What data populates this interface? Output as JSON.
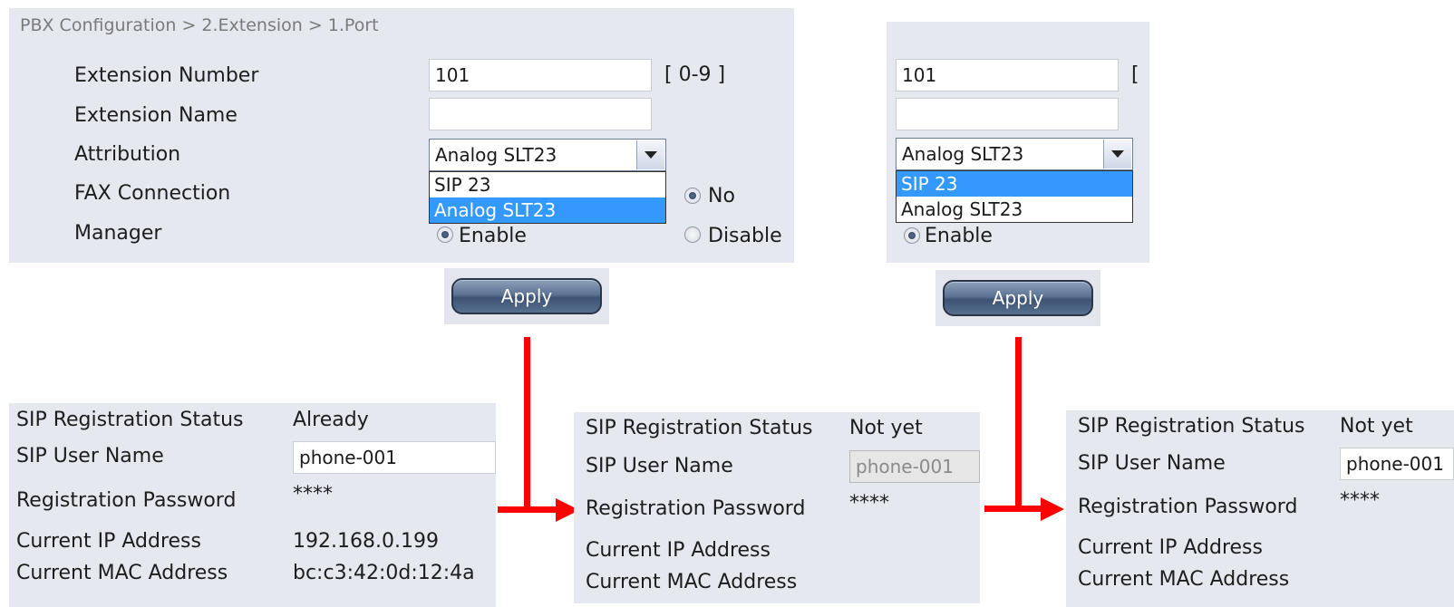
{
  "breadcrumb": "PBX Configuration > 2.Extension > 1.Port",
  "config_form": {
    "extension_number_label": "Extension Number",
    "extension_number_value": "101",
    "extension_number_hint": "[ 0-9 ]",
    "extension_name_label": "Extension Name",
    "extension_name_value": "",
    "attribution_label": "Attribution",
    "attribution_value": "Analog SLT23",
    "attribution_options": [
      "SIP 23",
      "Analog SLT23"
    ],
    "fax_label": "FAX Connection",
    "fax_no": "No",
    "manager_label": "Manager",
    "manager_enable": "Enable",
    "manager_disable": "Disable",
    "apply_label": "Apply"
  },
  "config_form_right": {
    "extension_number_value": "101",
    "hint_fragment": "[",
    "attribution_value": "Analog SLT23",
    "attribution_options": [
      "SIP 23",
      "Analog SLT23"
    ],
    "manager_enable": "Enable",
    "apply_label": "Apply"
  },
  "status_labels": {
    "reg_status": "SIP Registration Status",
    "user_name": "SIP User Name",
    "password": "Registration Password",
    "ip": "Current IP Address",
    "mac": "Current MAC Address"
  },
  "status_panels": [
    {
      "reg_status": "Already",
      "user_name": "phone-001",
      "password": "****",
      "ip": "192.168.0.199",
      "mac": "bc:c3:42:0d:12:4a"
    },
    {
      "reg_status": "Not yet",
      "user_name": "phone-001",
      "password": "****",
      "ip": "",
      "mac": ""
    },
    {
      "reg_status": "Not yet",
      "user_name": "phone-001",
      "password": "****",
      "ip": "",
      "mac": ""
    }
  ],
  "colors": {
    "arrow": "#ff0000",
    "highlight": "#3399ff",
    "panel": "#e5e8ef"
  }
}
